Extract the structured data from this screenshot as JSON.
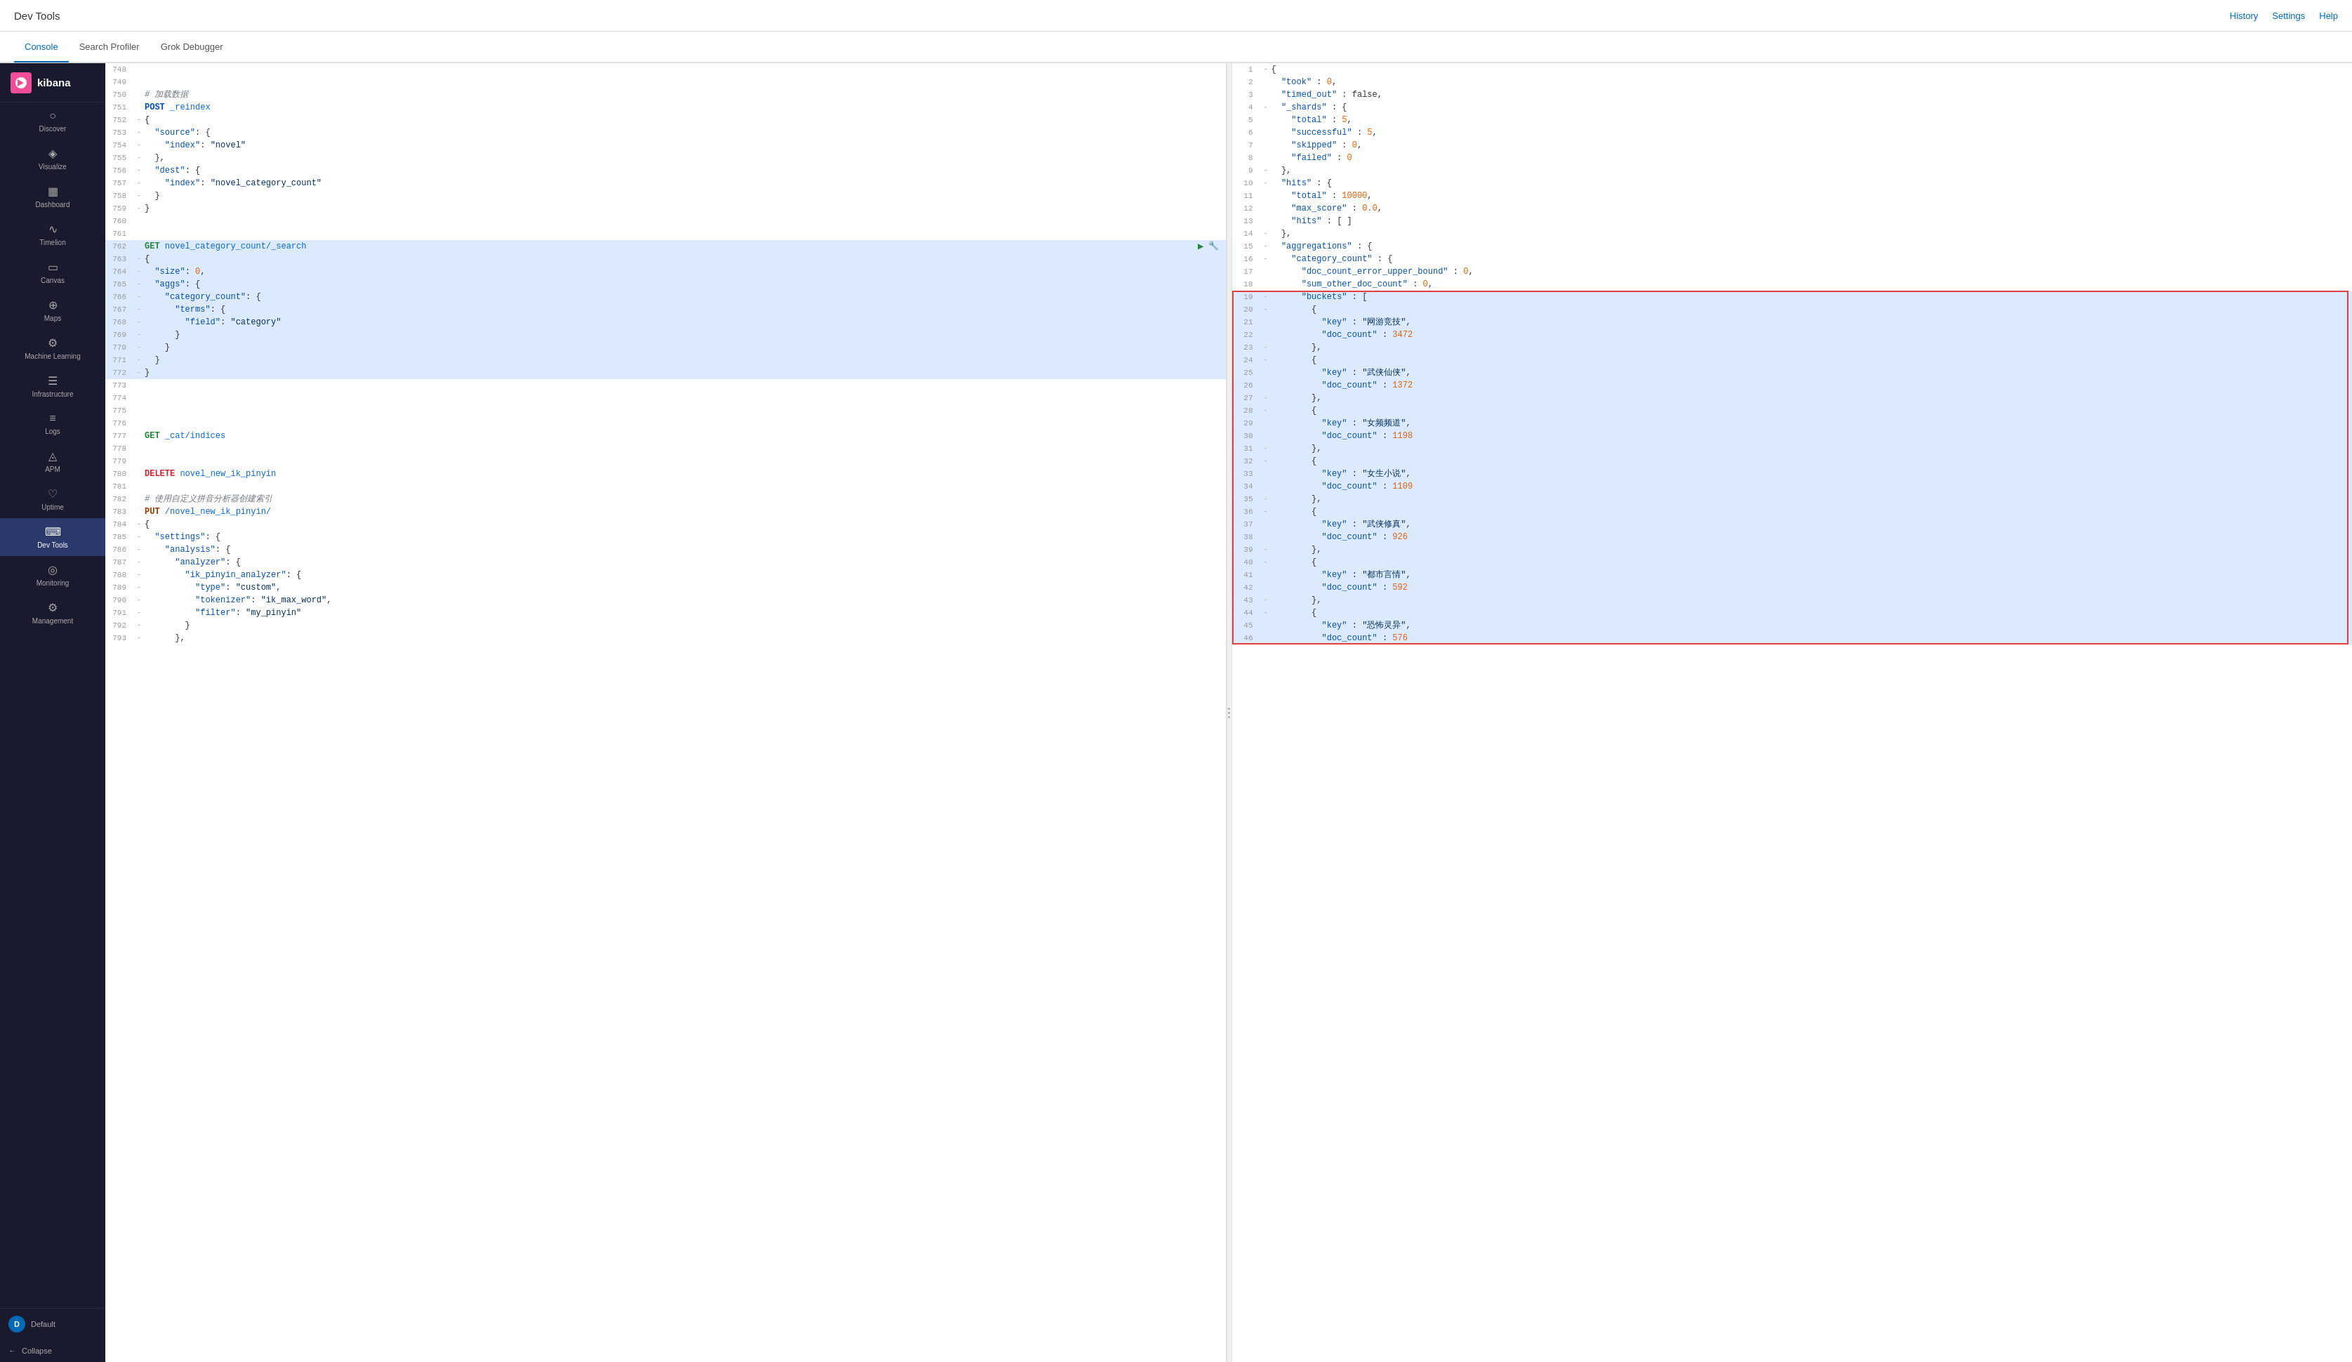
{
  "topBar": {
    "title": "Dev Tools",
    "actions": [
      "History",
      "Settings",
      "Help"
    ]
  },
  "tabs": [
    {
      "id": "console",
      "label": "Console",
      "active": true
    },
    {
      "id": "search-profiler",
      "label": "Search Profiler",
      "active": false
    },
    {
      "id": "grok-debugger",
      "label": "Grok Debugger",
      "active": false
    }
  ],
  "sidebar": {
    "logo": "kibana",
    "items": [
      {
        "id": "discover",
        "label": "Discover",
        "icon": "○"
      },
      {
        "id": "visualize",
        "label": "Visualize",
        "icon": "◈"
      },
      {
        "id": "dashboard",
        "label": "Dashboard",
        "icon": "▦"
      },
      {
        "id": "timelion",
        "label": "Timelion",
        "icon": "∿"
      },
      {
        "id": "canvas",
        "label": "Canvas",
        "icon": "▭"
      },
      {
        "id": "maps",
        "label": "Maps",
        "icon": "⊕"
      },
      {
        "id": "ml",
        "label": "Machine Learning",
        "icon": "⚙"
      },
      {
        "id": "infrastructure",
        "label": "Infrastructure",
        "icon": "☰"
      },
      {
        "id": "logs",
        "label": "Logs",
        "icon": "≡"
      },
      {
        "id": "apm",
        "label": "APM",
        "icon": "◬"
      },
      {
        "id": "uptime",
        "label": "Uptime",
        "icon": "♡"
      },
      {
        "id": "devtools",
        "label": "Dev Tools",
        "icon": "⌨",
        "active": true
      },
      {
        "id": "monitoring",
        "label": "Monitoring",
        "icon": "◎"
      },
      {
        "id": "management",
        "label": "Management",
        "icon": "⚙"
      }
    ],
    "user": {
      "label": "Default",
      "initials": "D"
    },
    "collapse": "Collapse"
  },
  "editor": {
    "lines": [
      {
        "num": 748,
        "gutter": "",
        "content": ""
      },
      {
        "num": 749,
        "gutter": "",
        "content": ""
      },
      {
        "num": 750,
        "gutter": "",
        "content": "# 加载数据",
        "type": "comment"
      },
      {
        "num": 751,
        "gutter": "",
        "content": "POST _reindex",
        "type": "method",
        "method": "POST",
        "url": "_reindex"
      },
      {
        "num": 752,
        "gutter": "-",
        "content": "{",
        "type": "brace"
      },
      {
        "num": 753,
        "gutter": "-",
        "content": "  \"source\": {",
        "type": "obj-key",
        "key": "source"
      },
      {
        "num": 754,
        "gutter": "-",
        "content": "    \"index\": \"novel\"",
        "type": "kv",
        "key": "index",
        "val": "novel"
      },
      {
        "num": 755,
        "gutter": "-",
        "content": "  },",
        "type": "brace"
      },
      {
        "num": 756,
        "gutter": "-",
        "content": "  \"dest\": {",
        "type": "obj-key",
        "key": "dest"
      },
      {
        "num": 757,
        "gutter": "-",
        "content": "    \"index\": \"novel_category_count\"",
        "type": "kv",
        "key": "index",
        "val": "novel_category_count"
      },
      {
        "num": 758,
        "gutter": "-",
        "content": "  }",
        "type": "brace"
      },
      {
        "num": 759,
        "gutter": "-",
        "content": "}",
        "type": "brace"
      },
      {
        "num": 760,
        "gutter": "",
        "content": ""
      },
      {
        "num": 761,
        "gutter": "",
        "content": ""
      },
      {
        "num": 762,
        "gutter": "",
        "content": "GET novel_category_count/_search",
        "type": "method",
        "method": "GET",
        "url": "novel_category_count/_search",
        "active": true
      },
      {
        "num": 763,
        "gutter": "-",
        "content": "{",
        "type": "brace",
        "highlight": true
      },
      {
        "num": 764,
        "gutter": "-",
        "content": "  \"size\": 0,",
        "type": "kv-num",
        "key": "size",
        "val": "0",
        "highlight": true
      },
      {
        "num": 765,
        "gutter": "-",
        "content": "  \"aggs\": {",
        "type": "obj-key",
        "key": "aggs",
        "highlight": true
      },
      {
        "num": 766,
        "gutter": "-",
        "content": "    \"category_count\": {",
        "type": "obj-key",
        "key": "category_count",
        "highlight": true
      },
      {
        "num": 767,
        "gutter": "-",
        "content": "      \"terms\": {",
        "type": "obj-key",
        "key": "terms",
        "highlight": true
      },
      {
        "num": 768,
        "gutter": "-",
        "content": "        \"field\": \"category\"",
        "type": "kv",
        "key": "field",
        "val": "category",
        "highlight": true
      },
      {
        "num": 769,
        "gutter": "-",
        "content": "      }",
        "type": "brace",
        "highlight": true
      },
      {
        "num": 770,
        "gutter": "-",
        "content": "    }",
        "type": "brace",
        "highlight": true
      },
      {
        "num": 771,
        "gutter": "-",
        "content": "  }",
        "type": "brace",
        "highlight": true
      },
      {
        "num": 772,
        "gutter": "-",
        "content": "}",
        "type": "brace",
        "highlight": true
      },
      {
        "num": 773,
        "gutter": "",
        "content": ""
      },
      {
        "num": 774,
        "gutter": "",
        "content": ""
      },
      {
        "num": 775,
        "gutter": "",
        "content": ""
      },
      {
        "num": 776,
        "gutter": "",
        "content": ""
      },
      {
        "num": 777,
        "gutter": "",
        "content": "GET _cat/indices",
        "type": "method",
        "method": "GET",
        "url": "_cat/indices"
      },
      {
        "num": 778,
        "gutter": "",
        "content": ""
      },
      {
        "num": 779,
        "gutter": "",
        "content": ""
      },
      {
        "num": 780,
        "gutter": "",
        "content": "DELETE novel_new_ik_pinyin",
        "type": "method",
        "method": "DELETE",
        "url": "novel_new_ik_pinyin"
      },
      {
        "num": 781,
        "gutter": "",
        "content": ""
      },
      {
        "num": 782,
        "gutter": "",
        "content": "# 使用自定义拼音分析器创建索引",
        "type": "comment"
      },
      {
        "num": 783,
        "gutter": "",
        "content": "PUT /novel_new_ik_pinyin/",
        "type": "method",
        "method": "PUT",
        "url": "/novel_new_ik_pinyin/"
      },
      {
        "num": 784,
        "gutter": "-",
        "content": "{",
        "type": "brace"
      },
      {
        "num": 785,
        "gutter": "-",
        "content": "  \"settings\": {",
        "type": "obj-key",
        "key": "settings"
      },
      {
        "num": 786,
        "gutter": "-",
        "content": "    \"analysis\": {",
        "type": "obj-key",
        "key": "analysis"
      },
      {
        "num": 787,
        "gutter": "-",
        "content": "      \"analyzer\": {",
        "type": "obj-key",
        "key": "analyzer"
      },
      {
        "num": 788,
        "gutter": "-",
        "content": "        \"ik_pinyin_analyzer\": {",
        "type": "obj-key",
        "key": "ik_pinyin_analyzer"
      },
      {
        "num": 789,
        "gutter": "-",
        "content": "          \"type\": \"custom\",",
        "type": "kv",
        "key": "type",
        "val": "custom"
      },
      {
        "num": 790,
        "gutter": "-",
        "content": "          \"tokenizer\": \"ik_max_word\",",
        "type": "kv",
        "key": "tokenizer",
        "val": "ik_max_word"
      },
      {
        "num": 791,
        "gutter": "-",
        "content": "          \"filter\": \"my_pinyin\"",
        "type": "kv",
        "key": "filter",
        "val": "my_pinyin"
      },
      {
        "num": 792,
        "gutter": "-",
        "content": "        }",
        "type": "brace"
      },
      {
        "num": 793,
        "gutter": "-",
        "content": "      },",
        "type": "brace"
      }
    ]
  },
  "result": {
    "lines": [
      {
        "num": 1,
        "gutter": "-",
        "content": "{"
      },
      {
        "num": 2,
        "gutter": "",
        "content": "  \"took\" : 0,",
        "key": "took",
        "val": "0",
        "valType": "num"
      },
      {
        "num": 3,
        "gutter": "",
        "content": "  \"timed_out\" : false,",
        "key": "timed_out",
        "val": "false",
        "valType": "bool"
      },
      {
        "num": 4,
        "gutter": "-",
        "content": "  \"_shards\" : {",
        "key": "_shards"
      },
      {
        "num": 5,
        "gutter": "",
        "content": "    \"total\" : 5,",
        "key": "total",
        "val": "5",
        "valType": "num"
      },
      {
        "num": 6,
        "gutter": "",
        "content": "    \"successful\" : 5,",
        "key": "successful",
        "val": "5",
        "valType": "num"
      },
      {
        "num": 7,
        "gutter": "",
        "content": "    \"skipped\" : 0,",
        "key": "skipped",
        "val": "0",
        "valType": "num"
      },
      {
        "num": 8,
        "gutter": "",
        "content": "    \"failed\" : 0",
        "key": "failed",
        "val": "0",
        "valType": "num"
      },
      {
        "num": 9,
        "gutter": "-",
        "content": "  },"
      },
      {
        "num": 10,
        "gutter": "-",
        "content": "  \"hits\" : {",
        "key": "hits"
      },
      {
        "num": 11,
        "gutter": "",
        "content": "    \"total\" : 10000,",
        "key": "total",
        "val": "10000",
        "valType": "num"
      },
      {
        "num": 12,
        "gutter": "",
        "content": "    \"max_score\" : 0.0,",
        "key": "max_score",
        "val": "0.0",
        "valType": "num"
      },
      {
        "num": 13,
        "gutter": "",
        "content": "    \"hits\" : [ ]",
        "key": "hits",
        "val": "[ ]"
      },
      {
        "num": 14,
        "gutter": "-",
        "content": "  },"
      },
      {
        "num": 15,
        "gutter": "-",
        "content": "  \"aggregations\" : {",
        "key": "aggregations"
      },
      {
        "num": 16,
        "gutter": "-",
        "content": "    \"category_count\" : {",
        "key": "category_count"
      },
      {
        "num": 17,
        "gutter": "",
        "content": "      \"doc_count_error_upper_bound\" : 0,",
        "key": "doc_count_error_upper_bound",
        "val": "0",
        "valType": "num"
      },
      {
        "num": 18,
        "gutter": "",
        "content": "      \"sum_other_doc_count\" : 0,",
        "key": "sum_other_doc_count",
        "val": "0",
        "valType": "num"
      },
      {
        "num": 19,
        "gutter": "-",
        "content": "      \"buckets\" : [",
        "highlight": true
      },
      {
        "num": 20,
        "gutter": "-",
        "content": "        {",
        "highlight": true
      },
      {
        "num": 21,
        "gutter": "",
        "content": "          \"key\" : \"网游竞技\",",
        "highlight": true
      },
      {
        "num": 22,
        "gutter": "",
        "content": "          \"doc_count\" : 3472",
        "highlight": true,
        "val": "3472",
        "valType": "num"
      },
      {
        "num": 23,
        "gutter": "-",
        "content": "        },",
        "highlight": true
      },
      {
        "num": 24,
        "gutter": "-",
        "content": "        {",
        "highlight": true
      },
      {
        "num": 25,
        "gutter": "",
        "content": "          \"key\" : \"武侠仙侠\",",
        "highlight": true
      },
      {
        "num": 26,
        "gutter": "",
        "content": "          \"doc_count\" : 1372",
        "highlight": true,
        "val": "1372",
        "valType": "num"
      },
      {
        "num": 27,
        "gutter": "-",
        "content": "        },",
        "highlight": true
      },
      {
        "num": 28,
        "gutter": "-",
        "content": "        {",
        "highlight": true
      },
      {
        "num": 29,
        "gutter": "",
        "content": "          \"key\" : \"女频频道\",",
        "highlight": true
      },
      {
        "num": 30,
        "gutter": "",
        "content": "          \"doc_count\" : 1198",
        "highlight": true,
        "val": "1198",
        "valType": "num"
      },
      {
        "num": 31,
        "gutter": "-",
        "content": "        },",
        "highlight": true
      },
      {
        "num": 32,
        "gutter": "-",
        "content": "        {",
        "highlight": true
      },
      {
        "num": 33,
        "gutter": "",
        "content": "          \"key\" : \"女生小说\",",
        "highlight": true
      },
      {
        "num": 34,
        "gutter": "",
        "content": "          \"doc_count\" : 1109",
        "highlight": true,
        "val": "1109",
        "valType": "num"
      },
      {
        "num": 35,
        "gutter": "-",
        "content": "        },",
        "highlight": true
      },
      {
        "num": 36,
        "gutter": "-",
        "content": "        {",
        "highlight": true
      },
      {
        "num": 37,
        "gutter": "",
        "content": "          \"key\" : \"武侠修真\",",
        "highlight": true
      },
      {
        "num": 38,
        "gutter": "",
        "content": "          \"doc_count\" : 926",
        "highlight": true,
        "val": "926",
        "valType": "num"
      },
      {
        "num": 39,
        "gutter": "-",
        "content": "        },",
        "highlight": true
      },
      {
        "num": 40,
        "gutter": "-",
        "content": "        {",
        "highlight": true
      },
      {
        "num": 41,
        "gutter": "",
        "content": "          \"key\" : \"都市言情\",",
        "highlight": true
      },
      {
        "num": 42,
        "gutter": "",
        "content": "          \"doc_count\" : 592",
        "highlight": true,
        "val": "592",
        "valType": "num"
      },
      {
        "num": 43,
        "gutter": "-",
        "content": "        },",
        "highlight": true
      },
      {
        "num": 44,
        "gutter": "-",
        "content": "        {",
        "highlight": true
      },
      {
        "num": 45,
        "gutter": "",
        "content": "          \"key\" : \"恐怖灵异\",",
        "highlight": true
      },
      {
        "num": 46,
        "gutter": "",
        "content": "          \"doc_count\" : 576",
        "highlight": true,
        "val": "576",
        "valType": "num"
      }
    ]
  }
}
